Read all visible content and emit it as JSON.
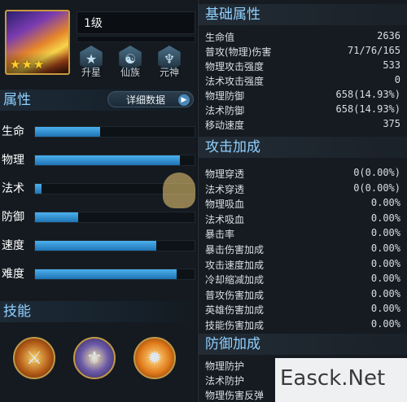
{
  "hero": {
    "level": "1级",
    "stars": [
      "★",
      "★",
      "★"
    ]
  },
  "actions": [
    {
      "label": "升星",
      "icon": "star-icon"
    },
    {
      "label": "仙族",
      "icon": "clan-icon"
    },
    {
      "label": "元神",
      "icon": "spirit-icon"
    }
  ],
  "attributes": {
    "title": "属性",
    "detail_button": "详细数据",
    "items": [
      {
        "label": "生命",
        "level": 0.41
      },
      {
        "label": "物理",
        "level": 0.91
      },
      {
        "label": "法术",
        "level": 0.04
      },
      {
        "label": "防御",
        "level": 0.27
      },
      {
        "label": "速度",
        "level": 0.76
      },
      {
        "label": "难度",
        "level": 0.89
      }
    ]
  },
  "skills": {
    "title": "技能",
    "items": [
      "skill-1-icon",
      "skill-2-icon",
      "skill-3-icon"
    ]
  },
  "base_stats": {
    "title": "基础属性",
    "rows": [
      {
        "label": "生命值",
        "value": "2636"
      },
      {
        "label": "普攻(物理)伤害",
        "value": "71/76/165"
      },
      {
        "label": "物理攻击强度",
        "value": "533"
      },
      {
        "label": "法术攻击强度",
        "value": "0"
      },
      {
        "label": "物理防御",
        "value": "658(14.93%)"
      },
      {
        "label": "法术防御",
        "value": "658(14.93%)"
      },
      {
        "label": "移动速度",
        "value": "375"
      }
    ]
  },
  "attack_bonus": {
    "title": "攻击加成",
    "rows": [
      {
        "label": "物理穿透",
        "value": "0(0.00%)"
      },
      {
        "label": "法术穿透",
        "value": "0(0.00%)"
      },
      {
        "label": "物理吸血",
        "value": "0.00%"
      },
      {
        "label": "法术吸血",
        "value": "0.00%"
      },
      {
        "label": "暴击率",
        "value": "0.00%"
      },
      {
        "label": "暴击伤害加成",
        "value": "0.00%"
      },
      {
        "label": "攻击速度加成",
        "value": "0.00%"
      },
      {
        "label": "冷却缩减加成",
        "value": "0.00%"
      },
      {
        "label": "普攻伤害加成",
        "value": "0.00%"
      },
      {
        "label": "英雄伤害加成",
        "value": "0.00%"
      },
      {
        "label": "技能伤害加成",
        "value": "0.00%"
      }
    ]
  },
  "defense_bonus": {
    "title": "防御加成",
    "rows": [
      {
        "label": "物理防护",
        "value": ""
      },
      {
        "label": "法术防护",
        "value": ""
      },
      {
        "label": "物理伤害反弹",
        "value": ""
      }
    ]
  },
  "watermark": {
    "text": "Easck.Net"
  },
  "colors": {
    "accent": "#8fd0ff",
    "bar": "#3a9ee0",
    "gold": "#c99a3c"
  }
}
